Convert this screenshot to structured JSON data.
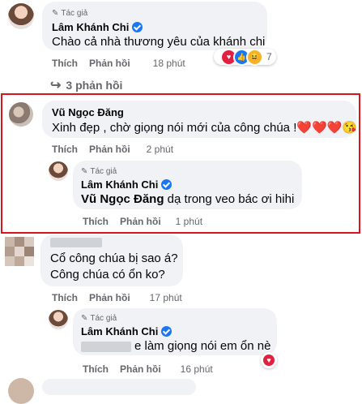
{
  "labels": {
    "author_badge": "Tác giả",
    "like": "Thích",
    "reply": "Phản hồi"
  },
  "comment1": {
    "author": "Lâm Khánh Chi",
    "text": "Chào cả nhà thương yêu của khánh chi",
    "time": "18 phút",
    "reaction_count": "7"
  },
  "replies_toggle": "3 phản hồi",
  "comment2": {
    "author": "Vũ Ngọc Đăng",
    "text": "Xinh đẹp , chờ giọng nói mới của công chúa !❤️❤️❤️😘",
    "time": "2 phút"
  },
  "reply2": {
    "author": "Lâm Khánh Chi",
    "mention": "Vũ Ngọc Đăng",
    "text": " dạ trong veo bác ơi hihi",
    "time": "1 phút"
  },
  "comment3": {
    "line1": "Cổ công chúa bị sao á?",
    "line2": "Công chúa có ổn ko?",
    "time": "17 phút"
  },
  "reply3": {
    "author": "Lâm Khánh Chi",
    "text": "e làm giọng nói em ổn nè",
    "time": "16 phút"
  },
  "colors": {
    "accent": "#1877f2",
    "highlight": "#d9141f",
    "bubble": "#f0f2f5",
    "heart": "#e41e3f"
  },
  "icons": [
    "verified-icon",
    "pen-icon",
    "reply-arrow-icon",
    "heart-icon",
    "like-icon",
    "haha-icon"
  ]
}
